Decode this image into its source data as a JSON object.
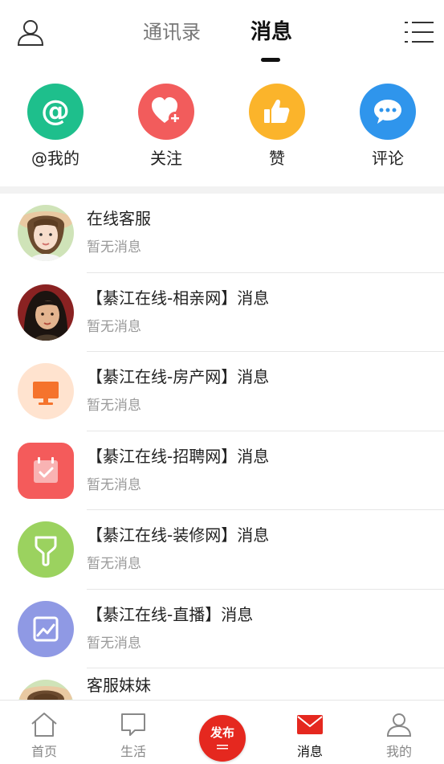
{
  "header": {
    "tabs": [
      {
        "label": "通讯录",
        "active": false
      },
      {
        "label": "消息",
        "active": true
      }
    ],
    "user_icon": "user-outline-icon",
    "menu_icon": "list-menu-icon"
  },
  "quick_actions": [
    {
      "label": "@我的",
      "icon": "at-icon",
      "color": "#1ebf8c"
    },
    {
      "label": "关注",
      "icon": "heart-plus-icon",
      "color": "#f25c5c"
    },
    {
      "label": "赞",
      "icon": "thumbs-up-icon",
      "color": "#fbb42b"
    },
    {
      "label": "评论",
      "icon": "chat-bubble-icon",
      "color": "#2f95ec"
    }
  ],
  "conversations": [
    {
      "title": "在线客服",
      "subtitle": "暂无消息",
      "avatar": "photo-girl-hat"
    },
    {
      "title": "【綦江在线-相亲网】消息",
      "subtitle": "暂无消息",
      "avatar": "photo-woman-portrait"
    },
    {
      "title": "【綦江在线-房产网】消息",
      "subtitle": "暂无消息",
      "avatar": "monitor-icon",
      "color": "#ffe3cf"
    },
    {
      "title": "【綦江在线-招聘网】消息",
      "subtitle": "暂无消息",
      "avatar": "calendar-check-icon",
      "color": "#f45b5b"
    },
    {
      "title": "【綦江在线-装修网】消息",
      "subtitle": "暂无消息",
      "avatar": "brush-icon",
      "color": "#9bd25f"
    },
    {
      "title": "【綦江在线-直播】消息",
      "subtitle": "暂无消息",
      "avatar": "chart-frame-icon",
      "color": "#8f99e4"
    },
    {
      "title": "客服妹妹",
      "subtitle": "",
      "avatar": "photo-girl-hat"
    }
  ],
  "bottom_nav": [
    {
      "label": "首页",
      "icon": "home-icon",
      "active": false
    },
    {
      "label": "生活",
      "icon": "speech-box-icon",
      "active": false
    },
    {
      "label": "发布",
      "icon": "publish-button",
      "active": false
    },
    {
      "label": "消息",
      "icon": "mail-icon",
      "active": true
    },
    {
      "label": "我的",
      "icon": "user-icon",
      "active": false
    }
  ],
  "colors": {
    "accent": "#e5281f",
    "divider": "#e6e6e6"
  }
}
